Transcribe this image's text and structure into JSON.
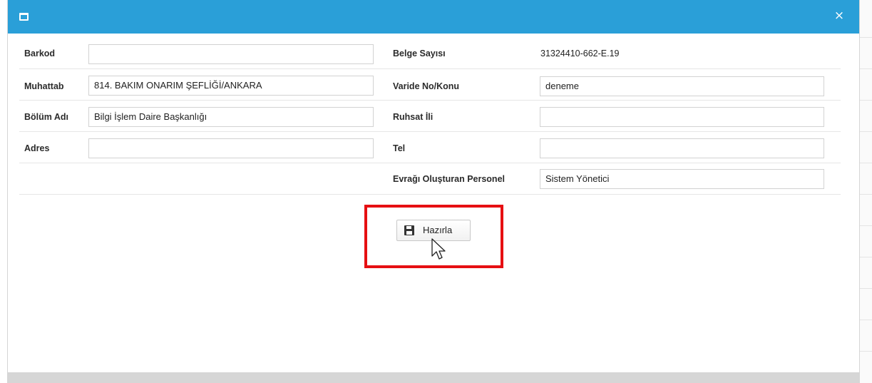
{
  "window": {
    "icon": "window-icon",
    "close_glyph": "×"
  },
  "form": {
    "barkod": {
      "label": "Barkod",
      "value": ""
    },
    "belge_sayisi": {
      "label": "Belge Sayısı",
      "value": "31324410-662-E.19"
    },
    "muhattab": {
      "label": "Muhattab",
      "value": "814. BAKIM ONARIM ŞEFLİĞİ/ANKARA"
    },
    "varide": {
      "label": "Varide No/Konu",
      "value": "deneme"
    },
    "bolum_adi": {
      "label": "Bölüm Adı",
      "value": "Bilgi İşlem Daire Başkanlığı"
    },
    "ruhsat_ili": {
      "label": "Ruhsat İli",
      "value": ""
    },
    "adres": {
      "label": "Adres",
      "value": ""
    },
    "tel": {
      "label": "Tel",
      "value": ""
    },
    "personel": {
      "label": "Evrağı Oluşturan Personel",
      "value": "Sistem Yönetici"
    }
  },
  "actions": {
    "prepare_label": "Hazırla",
    "prepare_icon": "save-icon"
  },
  "colors": {
    "titlebar": "#2a9fd8",
    "highlight": "#e60f12"
  }
}
